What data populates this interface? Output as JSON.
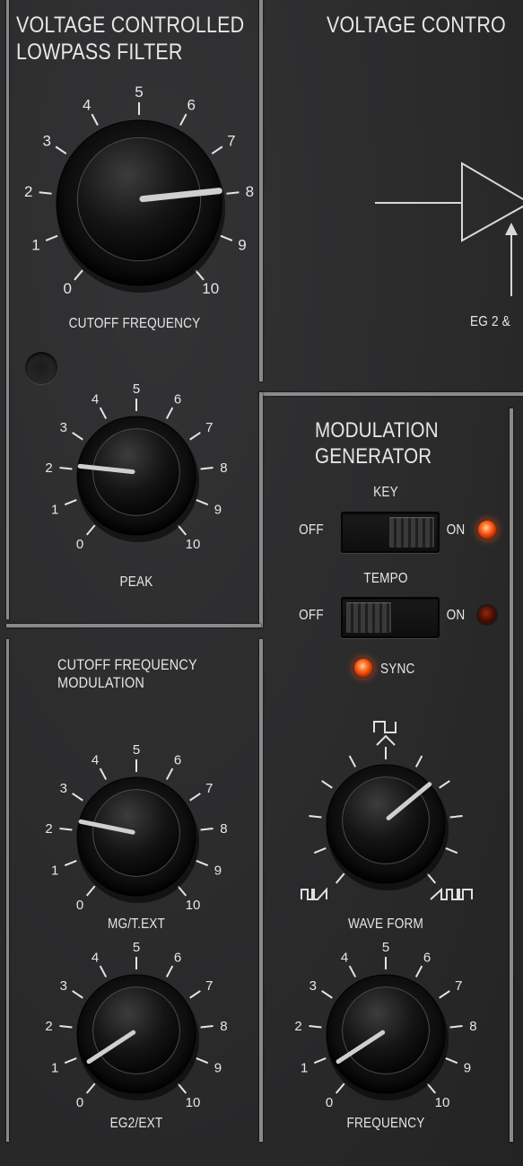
{
  "vcf": {
    "title_line1": "VOLTAGE CONTROLLED",
    "title_line2": "LOWPASS FILTER",
    "cutoff_label": "CUTOFF FREQUENCY",
    "peak_label": "PEAK",
    "cutoff_value": 8,
    "peak_value": 2
  },
  "vca": {
    "title": "VOLTAGE CONTRO",
    "eg_label": "EG 2 &"
  },
  "cfm": {
    "title_line1": "CUTOFF FREQUENCY",
    "title_line2": "MODULATION",
    "mg_label": "MG/T.EXT",
    "eg_label": "EG2/EXT",
    "mg_value": 2.2,
    "eg_value": 0.6
  },
  "mg": {
    "title_line1": "MODULATION",
    "title_line2": "GENERATOR",
    "key_label": "KEY",
    "key_off": "OFF",
    "key_on": "ON",
    "key_state": "on",
    "tempo_label": "TEMPO",
    "tempo_off": "OFF",
    "tempo_on": "ON",
    "tempo_state": "off",
    "sync_label": "SYNC",
    "waveform_label": "WAVE FORM",
    "frequency_label": "FREQUENCY",
    "waveform_value": 0.68,
    "frequency_value": 0.6
  },
  "scale": [
    "0",
    "1",
    "2",
    "3",
    "4",
    "5",
    "6",
    "7",
    "8",
    "9",
    "10"
  ],
  "colors": {
    "panel": "#2b2b2c",
    "divider": "#8a8a8c",
    "led_on": "#ff5a14",
    "led_off": "#4a0c00",
    "pointer": "#cfcfcf"
  }
}
